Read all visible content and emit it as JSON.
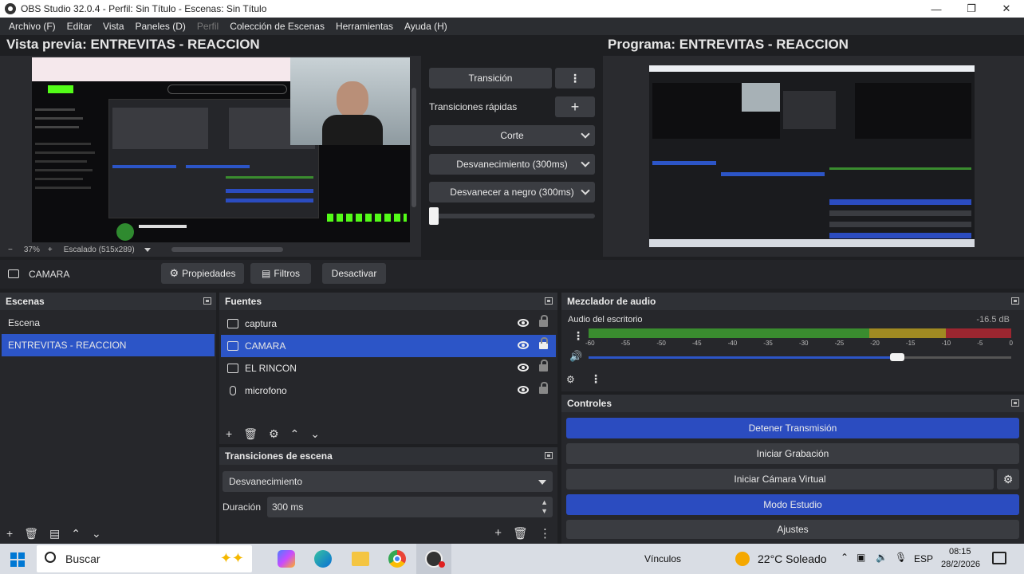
{
  "window": {
    "title": "OBS Studio 32.0.4 - Perfil: Sin Título - Escenas: Sin Título",
    "minimize": "—",
    "maximize": "❐",
    "close": "✕"
  },
  "menu": [
    "Archivo (F)",
    "Editar",
    "Vista",
    "Paneles (D)",
    "Perfil",
    "Colección de Escenas",
    "Herramientas",
    "Ayuda (H)"
  ],
  "preview": {
    "title": "Vista previa: ENTREVITAS  - REACCION",
    "zoom": "37%",
    "zoom_minus": "−",
    "zoom_plus": "+",
    "scale_label": "Escalado (515x289)"
  },
  "program": {
    "title": "Programa: ENTREVITAS  - REACCION"
  },
  "transition_panel": {
    "transition_btn": "Transición",
    "quick_label": "Transiciones rápidas",
    "quick_options": [
      "Corte",
      "Desvanecimiento (300ms)",
      "Desvanecer a negro (300ms)"
    ]
  },
  "source_toolbar": {
    "source_name": "CAMARA",
    "properties": "Propiedades",
    "filters": "Filtros",
    "deactivate": "Desactivar"
  },
  "scenes": {
    "title": "Escenas",
    "items": [
      "Escena",
      "ENTREVITAS  - REACCION"
    ],
    "selected_index": 1
  },
  "sources": {
    "title": "Fuentes",
    "items": [
      {
        "name": "captura",
        "icon": "monitor-icon"
      },
      {
        "name": "CAMARA",
        "icon": "camera-icon"
      },
      {
        "name": "EL RINCON",
        "icon": "window-icon"
      },
      {
        "name": "microfono",
        "icon": "microphone-icon"
      }
    ],
    "selected_index": 1
  },
  "scene_transitions": {
    "title": "Transiciones de escena",
    "selected": "Desvanecimiento",
    "duration_label": "Duración",
    "duration_value": "300 ms"
  },
  "mixer": {
    "title": "Mezclador de audio",
    "channel": "Audio del escritorio",
    "db": "-16.5 dB",
    "scale": [
      "-60",
      "-55",
      "-50",
      "-45",
      "-40",
      "-35",
      "-30",
      "-25",
      "-20",
      "-15",
      "-10",
      "-5",
      "0"
    ],
    "volume_level": 0.73
  },
  "controls": {
    "title": "Controles",
    "buttons": [
      "Detener Transmisión",
      "Iniciar Grabación",
      "Iniciar Cámara Virtual",
      "Modo Estudio",
      "Ajustes"
    ]
  },
  "taskbar": {
    "search": "Buscar",
    "links": "Vínculos",
    "weather": "22°C  Soleado",
    "lang": "ESP",
    "time": "08:15",
    "date": "28/2/2026"
  },
  "colors": {
    "accent": "#2c55c7",
    "button_blue": "#2b4cc0",
    "meter_green": "#3a8c2f",
    "meter_yellow": "#a08a22",
    "meter_red": "#9c2630"
  }
}
